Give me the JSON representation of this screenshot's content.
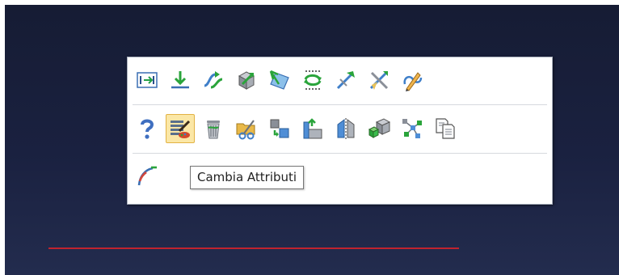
{
  "tooltip": {
    "text": "Cambia Attributi"
  },
  "toolbar": {
    "row1": [
      "insert-dimension-icon",
      "download-arrow-icon",
      "curve-arrows-icon",
      "cube-arrow-icon",
      "plane-arrow-icon",
      "rotate-arrows-icon",
      "tilted-tool-icon",
      "crossed-tools-icon",
      "pencil-curve-icon"
    ],
    "row2": [
      "help-icon",
      "change-attributes-icon",
      "trash-icon",
      "folder-tools-icon",
      "boxes-transfer-icon",
      "step-profile-icon",
      "mirror-icon",
      "cubes-icon",
      "network-icon",
      "copy-icon"
    ],
    "row3": [
      "curve-path-icon"
    ],
    "active_item": "change-attributes-icon"
  },
  "colors": {
    "background_top": "#161c34",
    "background_bottom": "#232c4e",
    "accent_line": "#c0232e",
    "active_highlight": "#fbe7a6"
  }
}
